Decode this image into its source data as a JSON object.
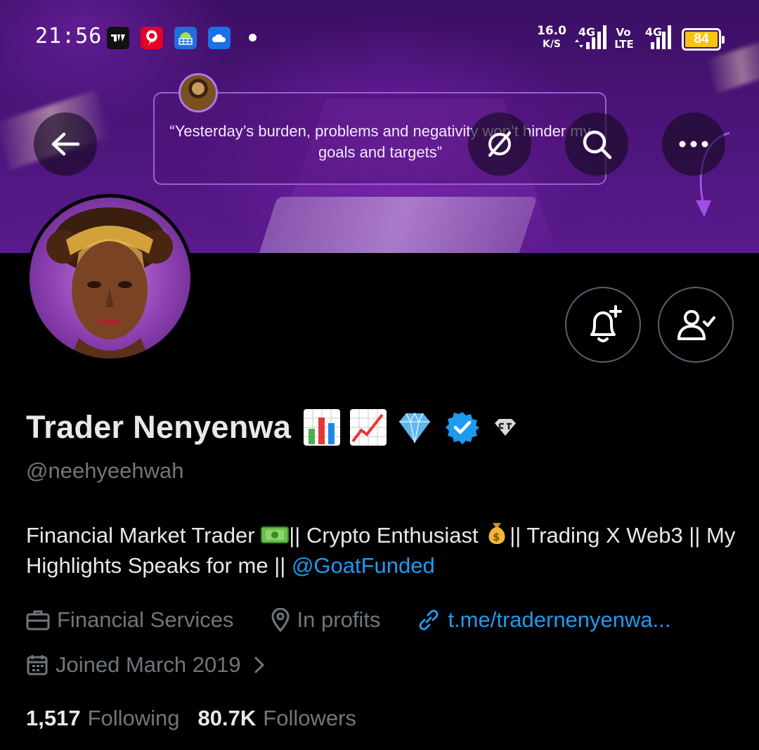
{
  "status_bar": {
    "time": "21:56",
    "net_speed_value": "16.0",
    "net_speed_unit": "K/S",
    "network_1": "4G",
    "volte_top": "Vo",
    "volte_bottom": "LTE",
    "network_2": "4G",
    "battery": "84",
    "notification_icons": [
      "tradingview-icon",
      "pinterest-icon",
      "android-debug-icon",
      "cloud-icon"
    ]
  },
  "banner": {
    "quote": "“Yesterday’s burden, problems and negativity won’t hinder my goals and targets”"
  },
  "profile": {
    "display_name": "Trader Nenyenwa",
    "handle": "@neehyeehwah",
    "verified": true,
    "bio_part1": "Financial Market Trader ",
    "bio_part2": "|| Crypto Enthusiast ",
    "bio_part3": "|| Trading X Web3 || My Highlights Speaks for me || ",
    "bio_mention": "@GoatFunded",
    "category": "Financial Services",
    "location": "In profits",
    "website": "t.me/tradernenyenwa...",
    "joined": "Joined March 2019",
    "following_count": "1,517",
    "following_label": "Following",
    "followers_count": "80.7K",
    "followers_label": "Followers"
  },
  "colors": {
    "accent": "#1d9bf0",
    "muted": "#71767b",
    "text": "#e7e9ea",
    "battery": "#f7c413"
  }
}
